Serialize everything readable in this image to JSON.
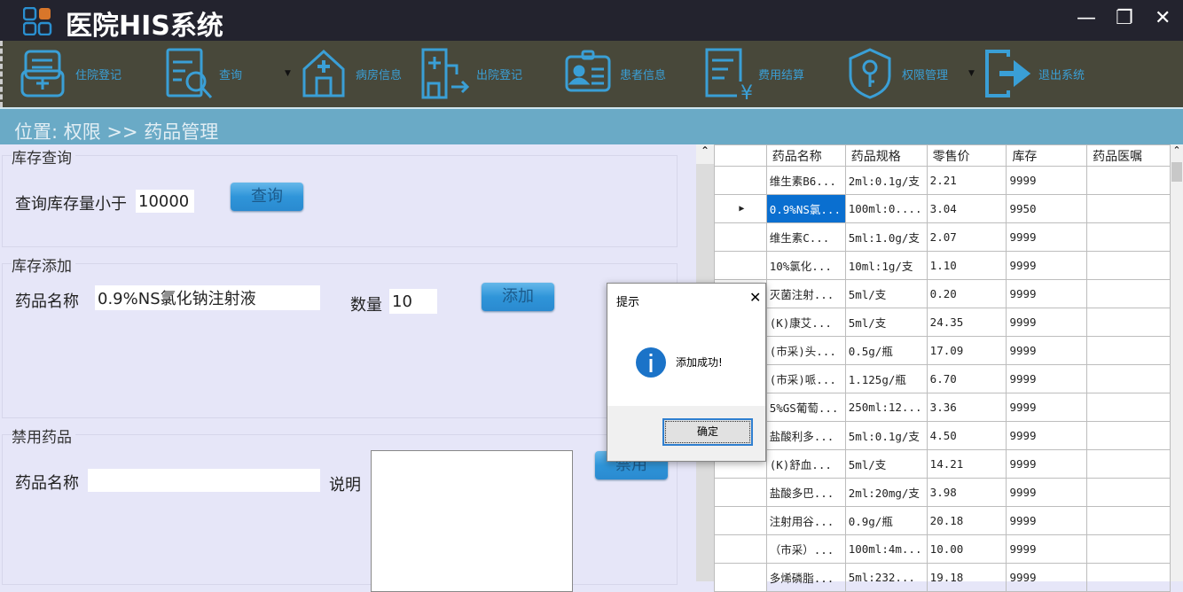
{
  "app": {
    "title": "医院HIS系统",
    "logo_icon": "grid-logo-icon"
  },
  "window": {
    "minimize": "—",
    "restore": "❐",
    "close": "✕"
  },
  "toolbar": [
    {
      "label": "住院登记",
      "icon": "admission-icon"
    },
    {
      "label": "查询",
      "icon": "search-doc-icon",
      "dropdown": true
    },
    {
      "label": "病房信息",
      "icon": "ward-icon"
    },
    {
      "label": "出院登记",
      "icon": "discharge-icon"
    },
    {
      "label": "患者信息",
      "icon": "patient-card-icon"
    },
    {
      "label": "费用结算",
      "icon": "billing-icon"
    },
    {
      "label": "权限管理",
      "icon": "shield-key-icon",
      "dropdown": true
    },
    {
      "label": "退出系统",
      "icon": "exit-icon"
    }
  ],
  "breadcrumb": "位置: 权限 >> 药品管理",
  "stock_query": {
    "title": "库存查询",
    "label": "查询库存量小于",
    "value": "10000",
    "button": "查询"
  },
  "stock_add": {
    "title": "库存添加",
    "name_label": "药品名称",
    "name_value": "0.9%NS氯化钠注射液",
    "qty_label": "数量",
    "qty_value": "10",
    "button": "添加"
  },
  "ban": {
    "title": "禁用药品",
    "name_label": "药品名称",
    "name_value": "",
    "desc_label": "说明",
    "desc_value": "",
    "button": "禁用"
  },
  "grid": {
    "columns": [
      "药品名称",
      "药品规格",
      "零售价",
      "库存",
      "药品医嘱"
    ],
    "selected_row": 1,
    "rows": [
      [
        "维生素B6...",
        "2ml:0.1g/支",
        "2.21",
        "9999",
        ""
      ],
      [
        "0.9%NS氯...",
        "100ml:0....",
        "3.04",
        "9950",
        ""
      ],
      [
        "维生素C...",
        "5ml:1.0g/支",
        "2.07",
        "9999",
        ""
      ],
      [
        "10%氯化...",
        "10ml:1g/支",
        "1.10",
        "9999",
        ""
      ],
      [
        "灭菌注射...",
        "5ml/支",
        "0.20",
        "9999",
        ""
      ],
      [
        "(K)康艾...",
        "5ml/支",
        "24.35",
        "9999",
        ""
      ],
      [
        "(市采)头...",
        "0.5g/瓶",
        "17.09",
        "9999",
        ""
      ],
      [
        "(市采)哌...",
        "1.125g/瓶",
        "6.70",
        "9999",
        ""
      ],
      [
        "5%GS葡萄...",
        "250ml:12...",
        "3.36",
        "9999",
        ""
      ],
      [
        "盐酸利多...",
        "5ml:0.1g/支",
        "4.50",
        "9999",
        ""
      ],
      [
        "(K)舒血...",
        "5ml/支",
        "14.21",
        "9999",
        ""
      ],
      [
        "盐酸多巴...",
        "2ml:20mg/支",
        "3.98",
        "9999",
        ""
      ],
      [
        "注射用谷...",
        "0.9g/瓶",
        "20.18",
        "9999",
        ""
      ],
      [
        "（市采）...",
        "100ml:4m...",
        "10.00",
        "9999",
        ""
      ],
      [
        "多烯磷脂...",
        "5ml:232...",
        "19.18",
        "9999",
        ""
      ]
    ]
  },
  "dialog": {
    "title": "提示",
    "message": "添加成功!",
    "ok": "确定",
    "icon": "info-icon",
    "close": "✕"
  }
}
